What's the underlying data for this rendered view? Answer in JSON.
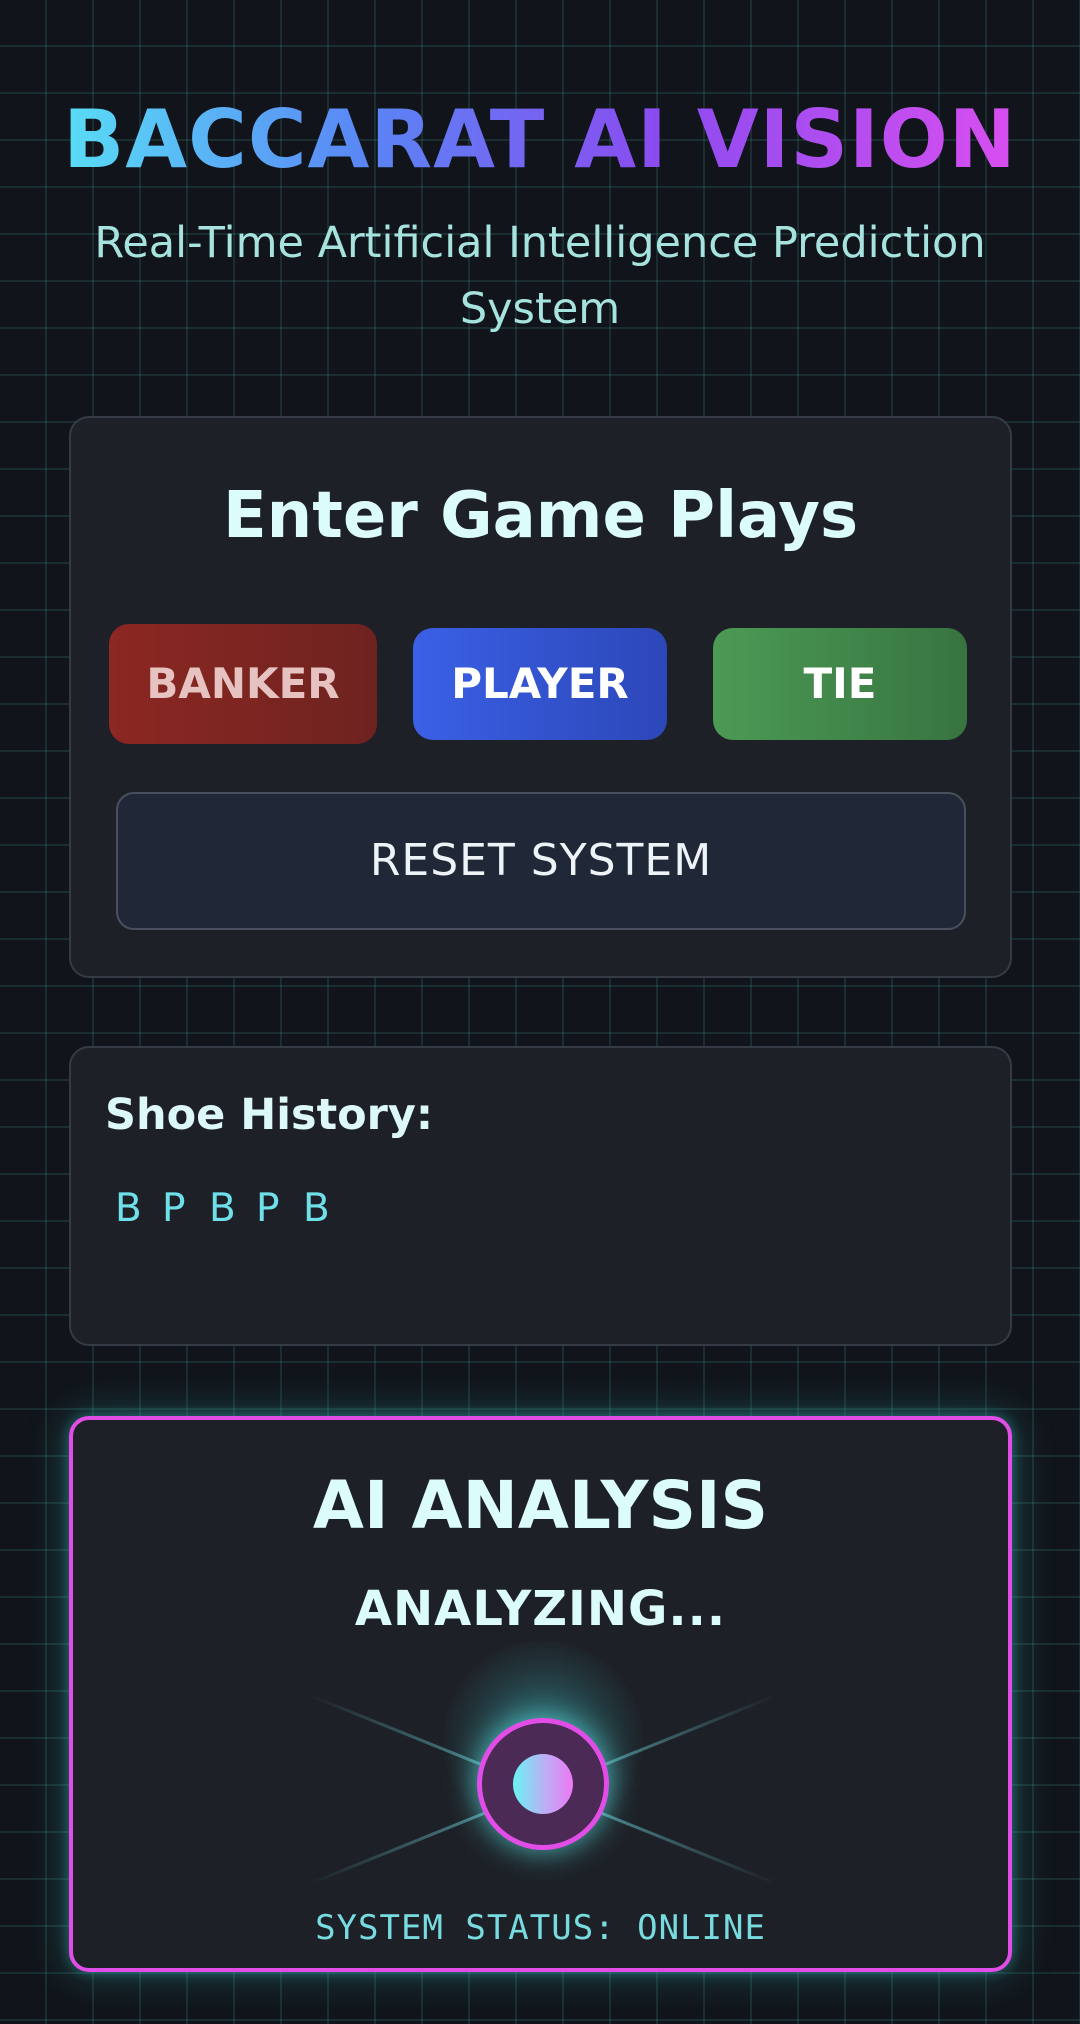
{
  "header": {
    "title": "BACCARAT AI VISION",
    "subtitle": "Real-Time Artificial Intelligence Prediction System"
  },
  "plays": {
    "title": "Enter Game Plays",
    "buttons": {
      "banker": "BANKER",
      "player": "PLAYER",
      "tie": "TIE"
    },
    "reset_label": "RESET SYSTEM"
  },
  "history": {
    "title": "Shoe History:",
    "items": [
      "B",
      "P",
      "B",
      "P",
      "B"
    ]
  },
  "ai": {
    "title": "AI ANALYSIS",
    "status": "ANALYZING...",
    "footer": "SYSTEM STATUS: ONLINE"
  },
  "colors": {
    "banker": "#8c2722",
    "player": "#3a60e6",
    "tie": "#4c9a55",
    "accent_pink": "#e24de8",
    "accent_cyan": "#6fe0ea"
  }
}
